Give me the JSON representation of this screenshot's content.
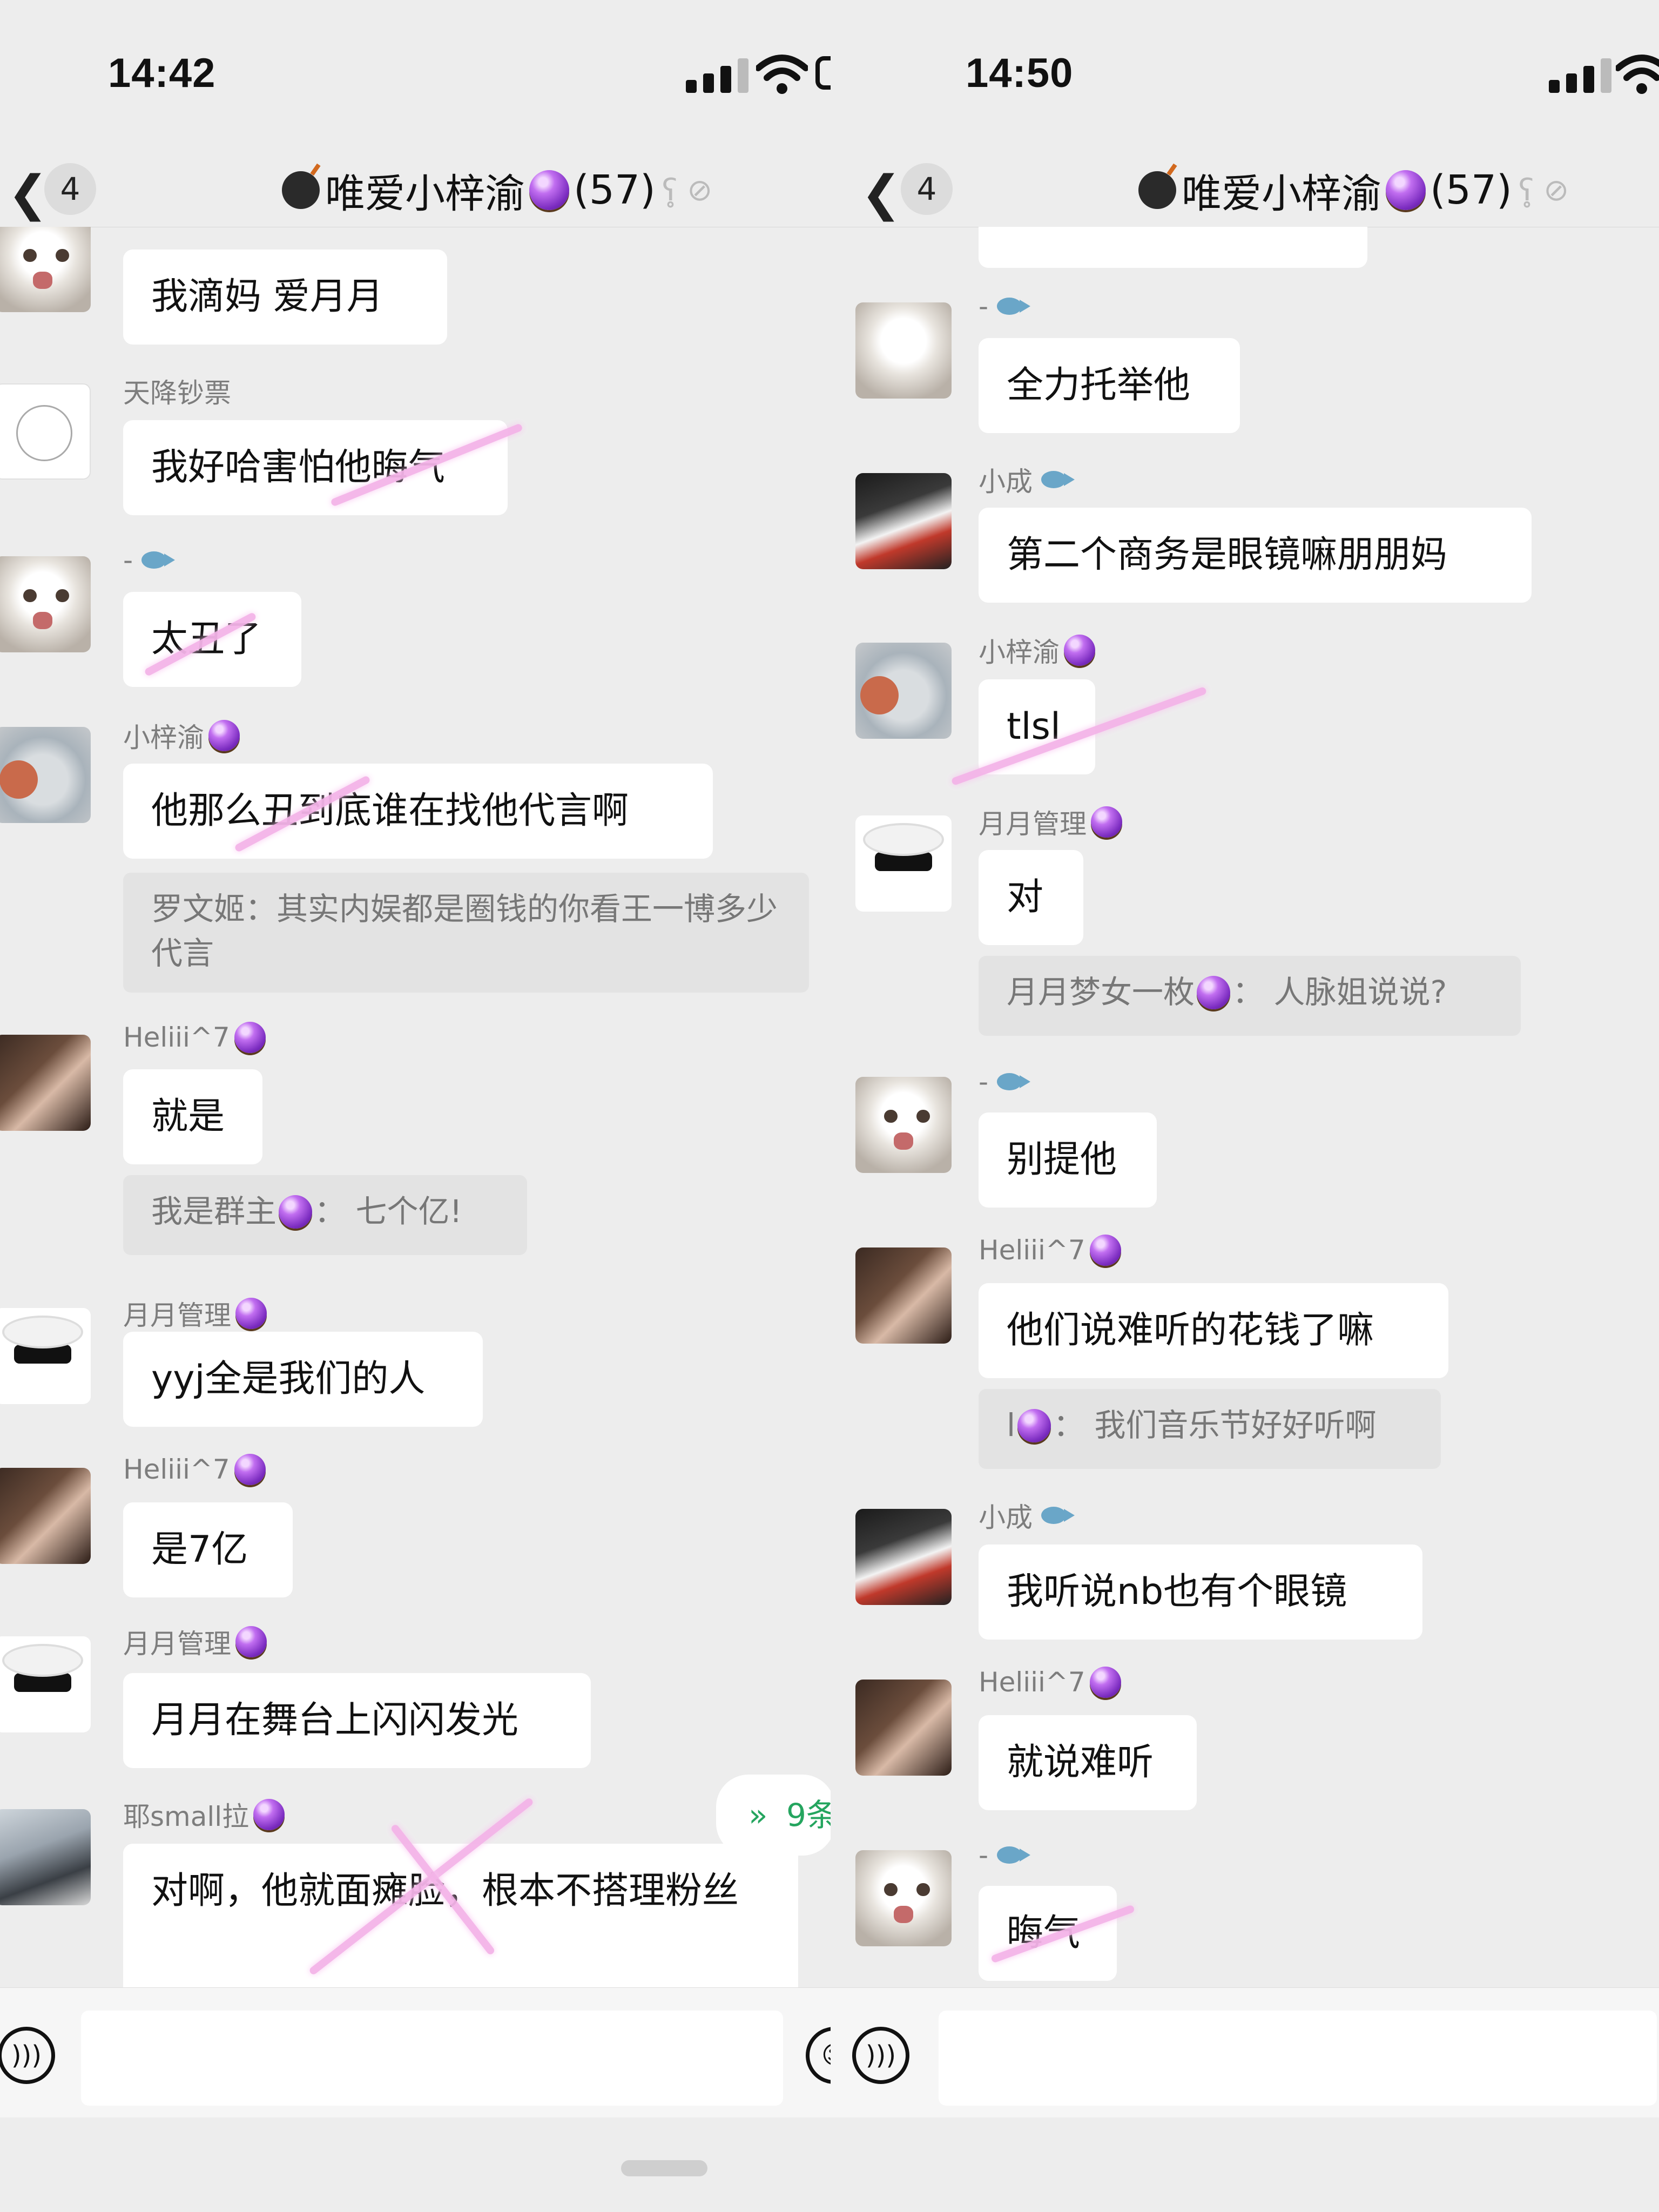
{
  "left": {
    "status": {
      "time": "14:42"
    },
    "nav": {
      "unread_count": "4",
      "title": "唯爱小梓渝",
      "member_count": "(57)"
    },
    "messages": [
      {
        "text": "我滴妈  爱月月"
      },
      {
        "name": "天降钞票",
        "text": "我好哈害怕他晦气"
      },
      {
        "name": "-",
        "text": "太丑了"
      },
      {
        "name": "小梓渝",
        "text": "他那么丑到底谁在找他代言啊",
        "quote": "罗文姬：其实内娱都是圈钱的你看王一博多少代言"
      },
      {
        "name": "Heliii^7",
        "text": "就是",
        "quote_name": "我是群主",
        "quote_text": "：  七个亿!"
      },
      {
        "name": "月月管理",
        "text": "yyj全是我们的人"
      },
      {
        "name": "Heliii^7",
        "text": "是7亿"
      },
      {
        "name": "月月管理",
        "text": "月月在舞台上闪闪发光"
      },
      {
        "name": "耶small拉",
        "text": "对啊，他就面瘫脸，根本不搭理粉丝"
      }
    ],
    "new_messages_pill": "9条"
  },
  "right": {
    "status": {
      "time": "14:50"
    },
    "nav": {
      "unread_count": "4",
      "title": "唯爱小梓渝",
      "member_count": "(57)"
    },
    "messages": [
      {
        "name": "-",
        "text": "全力托举他"
      },
      {
        "name": "小成",
        "text": "第二个商务是眼镜嘛朋朋妈"
      },
      {
        "name": "小梓渝",
        "text": "tlsl"
      },
      {
        "name": "月月管理",
        "text": "对",
        "quote_name": "月月梦女一枚",
        "quote_text": "：  人脉姐说说?"
      },
      {
        "name": "-",
        "text": "别提他"
      },
      {
        "name": "Heliii^7",
        "text": "他们说难听的花钱了嘛",
        "quote_name": "l",
        "quote_text": "：  我们音乐节好好听啊"
      },
      {
        "name": "小成",
        "text": "我听说nb也有个眼镜"
      },
      {
        "name": "Heliii^7",
        "text": "就说难听"
      },
      {
        "name": "-",
        "text": "晦气"
      }
    ]
  },
  "icons": {
    "back": "chevron-left-icon",
    "group_avatar": "bomb-icon",
    "badge": "purple-orb-icon",
    "fan_badge": "fish-icon",
    "mute": "bell-slash-icon",
    "voice": "voice-icon",
    "emoji": "emoji-icon",
    "new_msg": "double-chevron-down-icon"
  },
  "colors": {
    "background": "#ededed",
    "bubble": "#ffffff",
    "quote": "#e3e3e3",
    "strike": "#f4b4e8",
    "accent": "#25a55f"
  }
}
